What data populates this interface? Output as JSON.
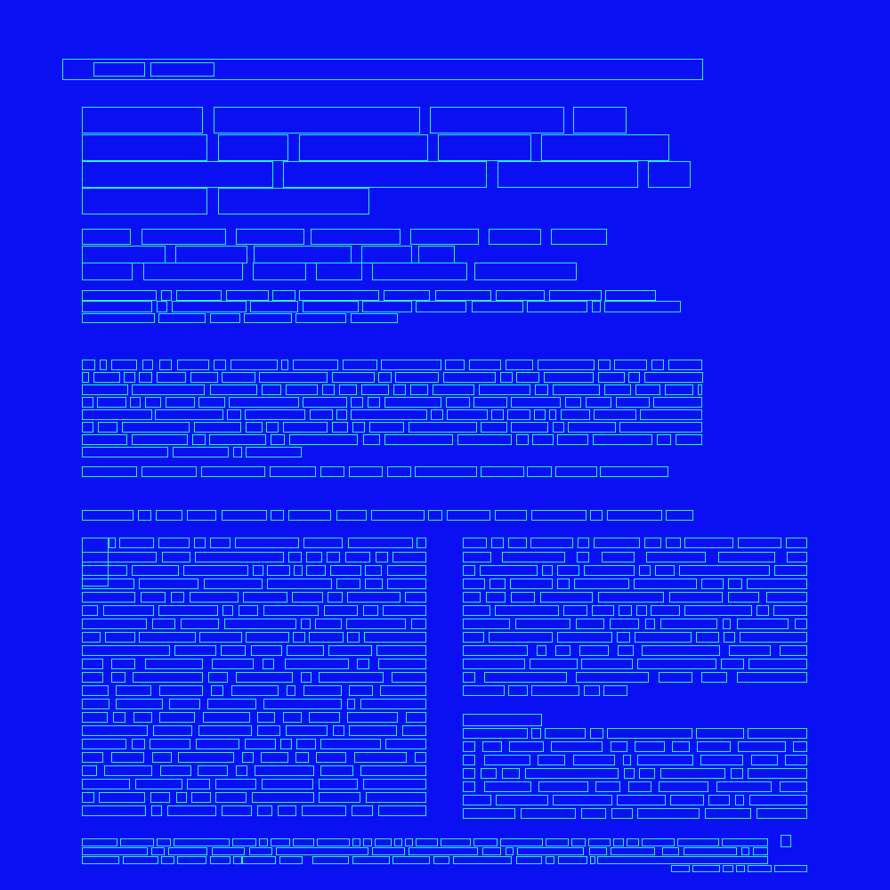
{
  "page": {
    "title": "",
    "background": "#0b10f3",
    "outline": "#24f2e6"
  },
  "top_bar": {
    "tab_1": "",
    "tab_2": ""
  },
  "sections": {
    "headline_blocks": [],
    "summary_rows": [],
    "paragraph_block": [],
    "left_column_lines": [],
    "right_column_lines": [],
    "footer_lines": []
  },
  "footer": {
    "icon": "info-icon"
  }
}
